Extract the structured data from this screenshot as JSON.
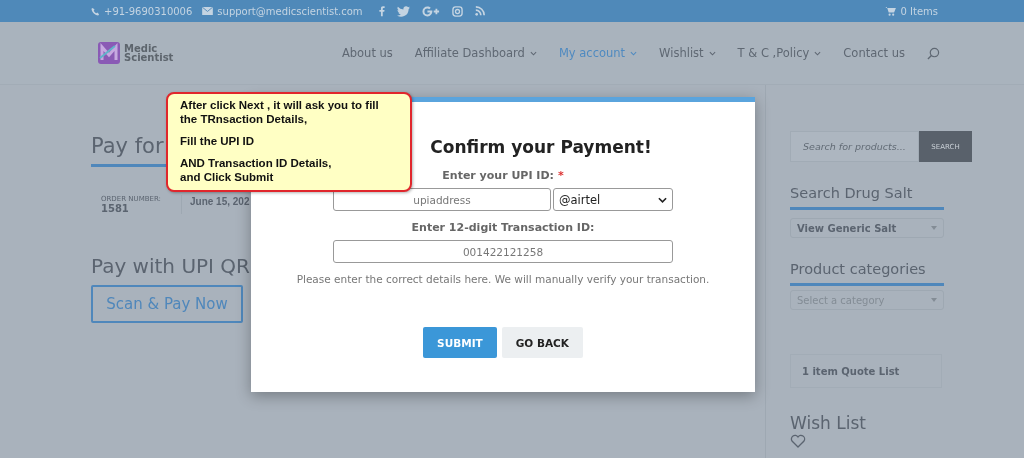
{
  "top_bar": {
    "phone": "+91-9690310006",
    "email": "support@medicscientist.com",
    "cart": "0 Items"
  },
  "header": {
    "logo": [
      "Medic",
      "Scientist"
    ],
    "nav": [
      {
        "label": "About us",
        "dropdown": false,
        "selected": false
      },
      {
        "label": "Affiliate Dashboard",
        "dropdown": true,
        "selected": false
      },
      {
        "label": "My account",
        "dropdown": true,
        "selected": true
      },
      {
        "label": "Wishlist",
        "dropdown": true,
        "selected": false
      },
      {
        "label": "T & C ,Policy",
        "dropdown": true,
        "selected": false
      },
      {
        "label": "Contact us",
        "dropdown": false,
        "selected": false
      }
    ]
  },
  "main": {
    "title": "Pay for",
    "order_label": "ORDER NUMBER:",
    "order_number": "1581",
    "date": "June 15, 202",
    "qr_title": "Pay with UPI QR",
    "scan_button": "Scan & Pay Now"
  },
  "sidebar": {
    "search": {
      "placeholder": "Search for products...",
      "button": "SEARCH"
    },
    "widgets": [
      {
        "kind": "select",
        "title": "Search Drug Salt",
        "value": "View Generic Salt"
      },
      {
        "kind": "select",
        "title": "Product categories",
        "placeholder": "Select a category"
      },
      {
        "kind": "box",
        "text": "1 item Quote List"
      },
      {
        "kind": "wishlist",
        "title": "Wish List"
      }
    ]
  },
  "modal": {
    "title": "Confirm your Payment!",
    "upi_label": "Enter your UPI ID:",
    "required_mark": "*",
    "upi_placeholder": "upiaddress",
    "provider": "@airtel",
    "txn_label": "Enter 12-digit Transaction ID:",
    "txn_placeholder": "001422121258",
    "note": "Please enter the correct details here. We will manually verify your transaction.",
    "buttons": [
      {
        "kind": "primary",
        "label": "SUBMIT"
      },
      {
        "kind": "secondary",
        "label": "GO BACK"
      }
    ]
  },
  "callout": {
    "paragraphs": [
      [
        "After click Next , it will ask you to fill",
        "the TRnsaction Details,"
      ],
      [
        "Fill the UPI ID"
      ],
      [
        "AND Transaction ID Details,",
        "and Click Submit"
      ]
    ]
  }
}
